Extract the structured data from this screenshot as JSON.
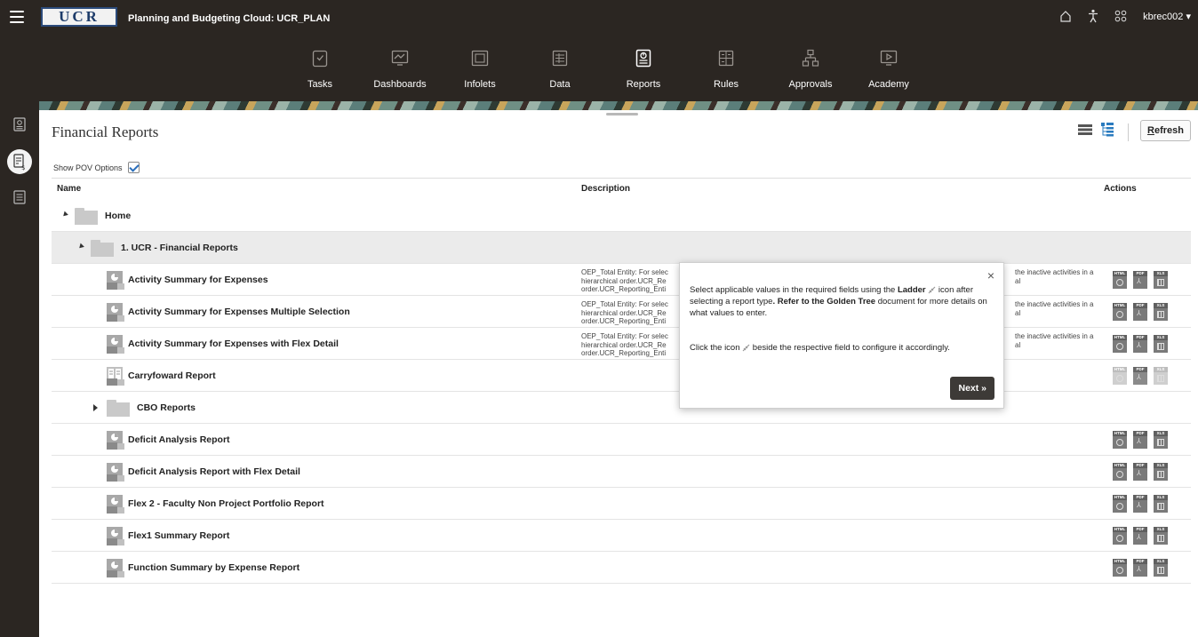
{
  "topbar": {
    "logo": "UCR",
    "app_title": "Planning and Budgeting Cloud: UCR_PLAN",
    "user": "kbrec002 ▾"
  },
  "nav": {
    "items": [
      {
        "label": "Tasks",
        "icon": "clipboard-check-icon"
      },
      {
        "label": "Dashboards",
        "icon": "dashboard-icon"
      },
      {
        "label": "Infolets",
        "icon": "infolets-icon"
      },
      {
        "label": "Data",
        "icon": "data-grid-icon"
      },
      {
        "label": "Reports",
        "icon": "reports-icon",
        "active": true
      },
      {
        "label": "Rules",
        "icon": "rules-icon"
      },
      {
        "label": "Approvals",
        "icon": "approvals-icon"
      },
      {
        "label": "Academy",
        "icon": "academy-icon"
      }
    ]
  },
  "page": {
    "title": "Financial Reports",
    "refresh_prefix": "R",
    "refresh_rest": "efresh",
    "show_pov_label": "Show POV Options"
  },
  "table": {
    "col_name": "Name",
    "col_description": "Description",
    "col_actions": "Actions",
    "rows": [
      {
        "name": "Home",
        "type": "folder",
        "level": 0,
        "expanded": true
      },
      {
        "name": "1. UCR - Financial Reports",
        "type": "folder",
        "level": 1,
        "expanded": true,
        "selected": true
      },
      {
        "name": "Activity Summary for Expenses",
        "type": "report",
        "desc_l1": "OEP_Total Entity: For selec",
        "desc_l2": "hierarchical order.UCR_Re",
        "desc_l3": "order.UCR_Reporting_Enti",
        "desc_r1": "the inactive activities in a",
        "desc_r2": "al"
      },
      {
        "name": "Activity Summary for Expenses Multiple Selection",
        "type": "report",
        "desc_l1": "OEP_Total Entity: For selec",
        "desc_l2": "hierarchical order.UCR_Re",
        "desc_l3": "order.UCR_Reporting_Enti",
        "desc_r1": "the inactive activities in a",
        "desc_r2": "al"
      },
      {
        "name": "Activity Summary for Expenses with Flex Detail",
        "type": "report",
        "desc_l1": "OEP_Total Entity: For selec",
        "desc_l2": "hierarchical order.UCR_Re",
        "desc_l3": "order.UCR_Reporting_Enti",
        "desc_r1": "the inactive activities in a",
        "desc_r2": "al"
      },
      {
        "name": "Carryfoward Report",
        "type": "report-alt"
      },
      {
        "name": "CBO Reports",
        "type": "folder",
        "level": 1,
        "expanded": false
      },
      {
        "name": "Deficit Analysis Report",
        "type": "report"
      },
      {
        "name": "Deficit Analysis Report with Flex Detail",
        "type": "report"
      },
      {
        "name": "Flex 2 - Faculty Non Project Portfolio Report",
        "type": "report"
      },
      {
        "name": "Flex1 Summary Report",
        "type": "report"
      },
      {
        "name": "Function Summary by Expense Report",
        "type": "report"
      }
    ],
    "action_labels": {
      "html": "HTML",
      "pdf": "PDF",
      "xls": "XLS"
    }
  },
  "popup": {
    "p1_a": "Select applicable values in the required fields using the ",
    "p1_b": "Ladder",
    "p1_c": " icon after selecting a report type",
    "p1_d": ". Refer to the ",
    "p1_e": "Golden Tree",
    "p1_f": " document for more details on what values to enter.",
    "p2_a": "Click the icon ",
    "p2_b": " beside the respective field to configure it accordingly.",
    "next_label": "Next »",
    "close": "×"
  }
}
